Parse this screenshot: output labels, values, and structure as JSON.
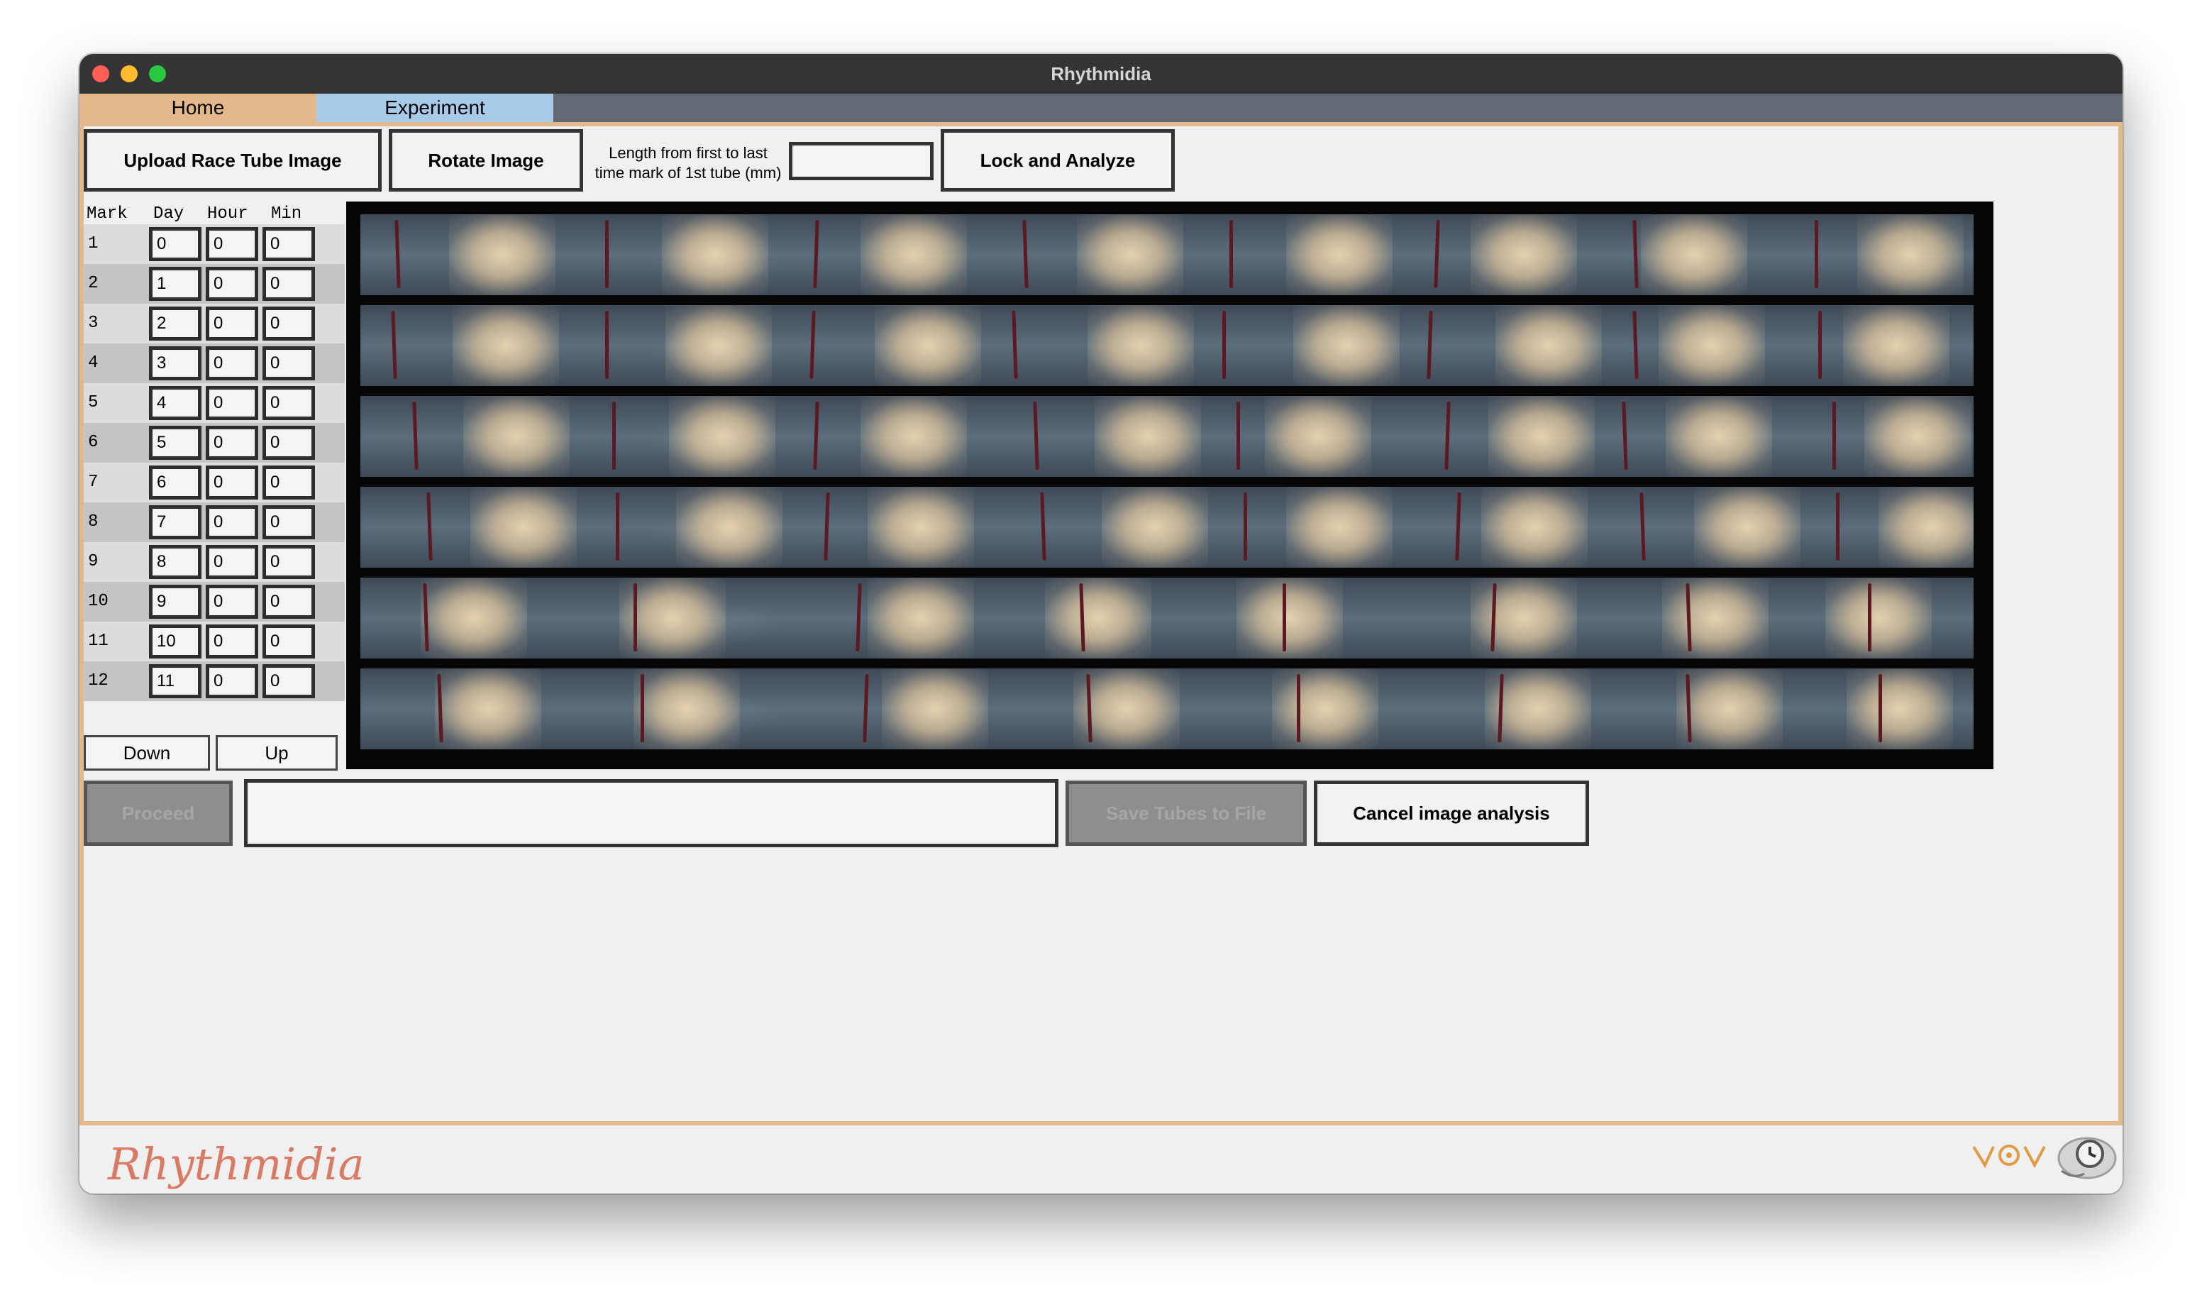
{
  "window": {
    "title": "Rhythmidia"
  },
  "tabs": [
    {
      "label": "Home",
      "color": "#e3b98b"
    },
    {
      "label": "Experiment",
      "color": "#a9cbea"
    }
  ],
  "toolbar": {
    "upload_label": "Upload Race Tube Image",
    "rotate_label": "Rotate Image",
    "length_label_line1": "Length from first to last",
    "length_label_line2": "time mark of 1st tube (mm)",
    "length_value": "",
    "lock_label": "Lock and Analyze"
  },
  "marks": {
    "headers": {
      "mark": "Mark",
      "day": "Day",
      "hour": "Hour",
      "min": "Min"
    },
    "rows": [
      {
        "mark": "1",
        "day": "0",
        "hour": "0",
        "min": "0"
      },
      {
        "mark": "2",
        "day": "1",
        "hour": "0",
        "min": "0"
      },
      {
        "mark": "3",
        "day": "2",
        "hour": "0",
        "min": "0"
      },
      {
        "mark": "4",
        "day": "3",
        "hour": "0",
        "min": "0"
      },
      {
        "mark": "5",
        "day": "4",
        "hour": "0",
        "min": "0"
      },
      {
        "mark": "6",
        "day": "5",
        "hour": "0",
        "min": "0"
      },
      {
        "mark": "7",
        "day": "6",
        "hour": "0",
        "min": "0"
      },
      {
        "mark": "8",
        "day": "7",
        "hour": "0",
        "min": "0"
      },
      {
        "mark": "9",
        "day": "8",
        "hour": "0",
        "min": "0"
      },
      {
        "mark": "10",
        "day": "9",
        "hour": "0",
        "min": "0"
      },
      {
        "mark": "11",
        "day": "10",
        "hour": "0",
        "min": "0"
      },
      {
        "mark": "12",
        "day": "11",
        "hour": "0",
        "min": "0"
      }
    ],
    "down_label": "Down",
    "up_label": "Up"
  },
  "bottom": {
    "proceed_label": "Proceed",
    "status_value": "",
    "save_label": "Save Tubes to File",
    "cancel_label": "Cancel image analysis"
  },
  "footer": {
    "logo_text": "Rhythmidia"
  },
  "colors": {
    "accent_orange": "#e3b98b",
    "accent_blue": "#a9cbea",
    "titlebar": "#343434",
    "tab_strip": "#636875"
  }
}
